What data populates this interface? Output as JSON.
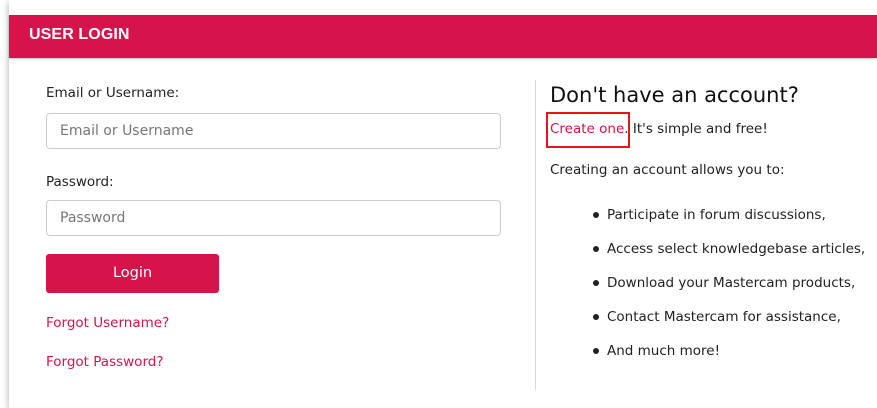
{
  "header": {
    "title": "USER LOGIN"
  },
  "login_form": {
    "email_label": "Email or Username:",
    "email_placeholder": "Email or Username",
    "password_label": "Password:",
    "password_placeholder": "Password",
    "login_label": "Login",
    "forgot_username": "Forgot Username?",
    "forgot_password": "Forgot Password?"
  },
  "signup_panel": {
    "title": "Don't have an account?",
    "create_link": "Create one",
    "create_suffix": ". It's simple and free!",
    "intro": "Creating an account allows you to:",
    "benefits": [
      "Participate in forum discussions,",
      "Access select knowledgebase articles,",
      "Download your Mastercam products,",
      "Contact Mastercam for assistance,",
      "And much more!"
    ]
  },
  "colors": {
    "brand": "#d4144a",
    "highlight": "#e8141a"
  }
}
